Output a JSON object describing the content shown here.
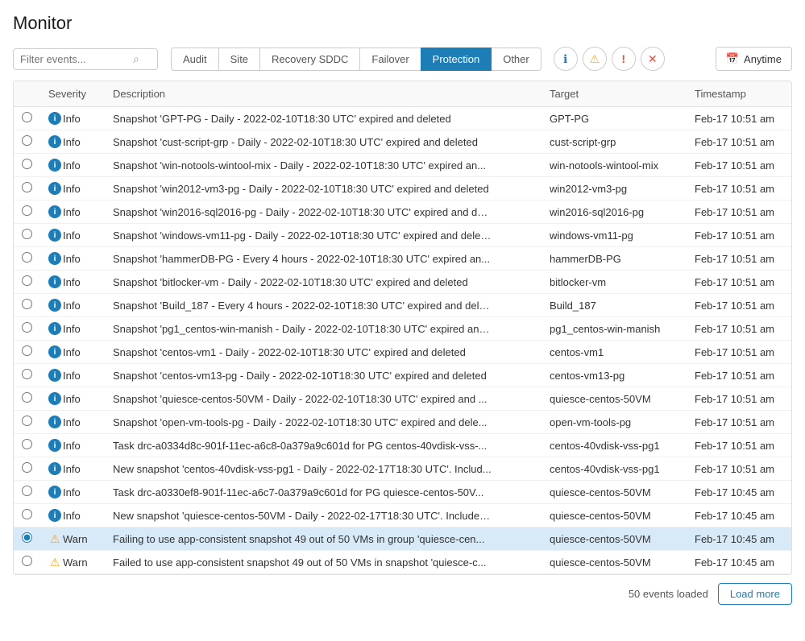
{
  "page": {
    "title": "Monitor"
  },
  "toolbar": {
    "filter_placeholder": "Filter events...",
    "tabs": [
      {
        "label": "Audit",
        "active": false
      },
      {
        "label": "Site",
        "active": false
      },
      {
        "label": "Recovery SDDC",
        "active": false
      },
      {
        "label": "Failover",
        "active": false
      },
      {
        "label": "Protection",
        "active": true
      },
      {
        "label": "Other",
        "active": false
      }
    ],
    "icon_filters": [
      {
        "name": "info-filter",
        "icon": "ℹ",
        "type": "info"
      },
      {
        "name": "warning-filter",
        "icon": "⚠",
        "type": "warning"
      },
      {
        "name": "error-filter",
        "icon": "!",
        "type": "error"
      },
      {
        "name": "cancel-filter",
        "icon": "✕",
        "type": "cancel"
      }
    ],
    "anytime_label": "Anytime",
    "calendar_icon": "📅"
  },
  "table": {
    "columns": [
      "",
      "Severity",
      "Description",
      "Target",
      "Timestamp"
    ],
    "rows": [
      {
        "selected": false,
        "type": "info",
        "severity": "Info",
        "description": "Snapshot 'GPT-PG - Daily - 2022-02-10T18:30 UTC' expired and deleted",
        "target": "GPT-PG",
        "timestamp": "Feb-17 10:51 am",
        "highlighted": false
      },
      {
        "selected": false,
        "type": "info",
        "severity": "Info",
        "description": "Snapshot 'cust-script-grp - Daily - 2022-02-10T18:30 UTC' expired and deleted",
        "target": "cust-script-grp",
        "timestamp": "Feb-17 10:51 am",
        "highlighted": false
      },
      {
        "selected": false,
        "type": "info",
        "severity": "Info",
        "description": "Snapshot 'win-notools-wintool-mix - Daily - 2022-02-10T18:30 UTC' expired an...",
        "target": "win-notools-wintool-mix",
        "timestamp": "Feb-17 10:51 am",
        "highlighted": false
      },
      {
        "selected": false,
        "type": "info",
        "severity": "Info",
        "description": "Snapshot 'win2012-vm3-pg - Daily - 2022-02-10T18:30 UTC' expired and deleted",
        "target": "win2012-vm3-pg",
        "timestamp": "Feb-17 10:51 am",
        "highlighted": false
      },
      {
        "selected": false,
        "type": "info",
        "severity": "Info",
        "description": "Snapshot 'win2016-sql2016-pg - Daily - 2022-02-10T18:30 UTC' expired and del...",
        "target": "win2016-sql2016-pg",
        "timestamp": "Feb-17 10:51 am",
        "highlighted": false
      },
      {
        "selected": false,
        "type": "info",
        "severity": "Info",
        "description": "Snapshot 'windows-vm11-pg - Daily - 2022-02-10T18:30 UTC' expired and delet...",
        "target": "windows-vm11-pg",
        "timestamp": "Feb-17 10:51 am",
        "highlighted": false
      },
      {
        "selected": false,
        "type": "info",
        "severity": "Info",
        "description": "Snapshot 'hammerDB-PG - Every 4 hours - 2022-02-10T18:30 UTC' expired an...",
        "target": "hammerDB-PG",
        "timestamp": "Feb-17 10:51 am",
        "highlighted": false
      },
      {
        "selected": false,
        "type": "info",
        "severity": "Info",
        "description": "Snapshot 'bitlocker-vm - Daily - 2022-02-10T18:30 UTC' expired and deleted",
        "target": "bitlocker-vm",
        "timestamp": "Feb-17 10:51 am",
        "highlighted": false
      },
      {
        "selected": false,
        "type": "info",
        "severity": "Info",
        "description": "Snapshot 'Build_187 - Every 4 hours - 2022-02-10T18:30 UTC' expired and dele...",
        "target": "Build_187",
        "timestamp": "Feb-17 10:51 am",
        "highlighted": false
      },
      {
        "selected": false,
        "type": "info",
        "severity": "Info",
        "description": "Snapshot 'pg1_centos-win-manish - Daily - 2022-02-10T18:30 UTC' expired and...",
        "target": "pg1_centos-win-manish",
        "timestamp": "Feb-17 10:51 am",
        "highlighted": false
      },
      {
        "selected": false,
        "type": "info",
        "severity": "Info",
        "description": "Snapshot 'centos-vm1 - Daily - 2022-02-10T18:30 UTC' expired and deleted",
        "target": "centos-vm1",
        "timestamp": "Feb-17 10:51 am",
        "highlighted": false
      },
      {
        "selected": false,
        "type": "info",
        "severity": "Info",
        "description": "Snapshot 'centos-vm13-pg - Daily - 2022-02-10T18:30 UTC' expired and deleted",
        "target": "centos-vm13-pg",
        "timestamp": "Feb-17 10:51 am",
        "highlighted": false
      },
      {
        "selected": false,
        "type": "info",
        "severity": "Info",
        "description": "Snapshot 'quiesce-centos-50VM - Daily - 2022-02-10T18:30 UTC' expired and ...",
        "target": "quiesce-centos-50VM",
        "timestamp": "Feb-17 10:51 am",
        "highlighted": false
      },
      {
        "selected": false,
        "type": "info",
        "severity": "Info",
        "description": "Snapshot 'open-vm-tools-pg - Daily - 2022-02-10T18:30 UTC' expired and dele...",
        "target": "open-vm-tools-pg",
        "timestamp": "Feb-17 10:51 am",
        "highlighted": false
      },
      {
        "selected": false,
        "type": "info",
        "severity": "Info",
        "description": "Task drc-a0334d8c-901f-11ec-a6c8-0a379a9c601d for PG centos-40vdisk-vss-...",
        "target": "centos-40vdisk-vss-pg1",
        "timestamp": "Feb-17 10:51 am",
        "highlighted": false
      },
      {
        "selected": false,
        "type": "info",
        "severity": "Info",
        "description": "New snapshot 'centos-40vdisk-vss-pg1 - Daily - 2022-02-17T18:30 UTC'. Includ...",
        "target": "centos-40vdisk-vss-pg1",
        "timestamp": "Feb-17 10:51 am",
        "highlighted": false
      },
      {
        "selected": false,
        "type": "info",
        "severity": "Info",
        "description": "Task drc-a0330ef8-901f-11ec-a6c7-0a379a9c601d for PG quiesce-centos-50V...",
        "target": "quiesce-centos-50VM",
        "timestamp": "Feb-17 10:45 am",
        "highlighted": false
      },
      {
        "selected": false,
        "type": "info",
        "severity": "Info",
        "description": "New snapshot 'quiesce-centos-50VM - Daily - 2022-02-17T18:30 UTC'. Includes...",
        "target": "quiesce-centos-50VM",
        "timestamp": "Feb-17 10:45 am",
        "highlighted": false
      },
      {
        "selected": true,
        "type": "warning",
        "severity": "Warn",
        "description": "Failing to use app-consistent snapshot 49 out of 50 VMs in group 'quiesce-cen...",
        "target": "quiesce-centos-50VM",
        "timestamp": "Feb-17 10:45 am",
        "highlighted": true
      },
      {
        "selected": false,
        "type": "warning",
        "severity": "Warn",
        "description": "Failed to use app-consistent snapshot 49 out of 50 VMs in snapshot 'quiesce-c...",
        "target": "quiesce-centos-50VM",
        "timestamp": "Feb-17 10:45 am",
        "highlighted": false
      }
    ]
  },
  "footer": {
    "events_loaded_label": "50 events loaded",
    "load_more_label": "Load more"
  }
}
